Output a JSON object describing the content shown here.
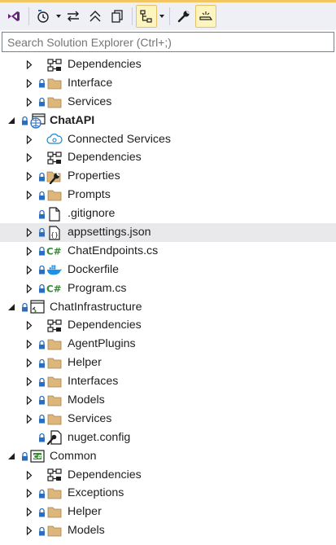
{
  "search": {
    "placeholder": "Search Solution Explorer (Ctrl+;)"
  },
  "toolbar": {
    "buttons": [
      {
        "icon": "vs-solution-icon"
      },
      {
        "icon": "history-icon",
        "dropdown": true
      },
      {
        "icon": "sync-icon"
      },
      {
        "icon": "collapse-all-icon"
      },
      {
        "icon": "copy-icon"
      },
      {
        "icon": "filter-tree-icon",
        "dropdown": true,
        "active": true
      },
      {
        "icon": "wrench-icon"
      },
      {
        "icon": "preview-icon",
        "active": true
      }
    ]
  },
  "tree": [
    {
      "label": "Dependencies",
      "icon": "dependencies-icon",
      "depth": 1,
      "expander": "collapsed",
      "lock": false
    },
    {
      "label": "Interface",
      "icon": "folder-icon",
      "depth": 1,
      "expander": "collapsed",
      "lock": true
    },
    {
      "label": "Services",
      "icon": "folder-icon",
      "depth": 1,
      "expander": "collapsed",
      "lock": true
    },
    {
      "label": "ChatAPI",
      "icon": "web-project-icon",
      "depth": 0,
      "expander": "expanded",
      "lock": true,
      "bold": true
    },
    {
      "label": "Connected Services",
      "icon": "connected-services-icon",
      "depth": 1,
      "expander": "collapsed",
      "lock": false
    },
    {
      "label": "Dependencies",
      "icon": "dependencies-icon",
      "depth": 1,
      "expander": "collapsed",
      "lock": false
    },
    {
      "label": "Properties",
      "icon": "properties-icon",
      "depth": 1,
      "expander": "collapsed",
      "lock": true
    },
    {
      "label": "Prompts",
      "icon": "folder-icon",
      "depth": 1,
      "expander": "collapsed",
      "lock": true
    },
    {
      "label": ".gitignore",
      "icon": "file-icon",
      "depth": 1,
      "expander": "none",
      "lock": true
    },
    {
      "label": "appsettings.json",
      "icon": "json-file-icon",
      "depth": 1,
      "expander": "collapsed",
      "lock": true,
      "selected": true
    },
    {
      "label": "ChatEndpoints.cs",
      "icon": "csharp-file-icon",
      "depth": 1,
      "expander": "collapsed",
      "lock": true
    },
    {
      "label": "Dockerfile",
      "icon": "docker-icon",
      "depth": 1,
      "expander": "collapsed",
      "lock": true
    },
    {
      "label": "Program.cs",
      "icon": "csharp-file-icon",
      "depth": 1,
      "expander": "collapsed",
      "lock": true
    },
    {
      "label": "ChatInfrastructure",
      "icon": "library-project-icon",
      "depth": 0,
      "expander": "expanded",
      "lock": true
    },
    {
      "label": "Dependencies",
      "icon": "dependencies-icon",
      "depth": 1,
      "expander": "collapsed",
      "lock": false
    },
    {
      "label": "AgentPlugins",
      "icon": "folder-icon",
      "depth": 1,
      "expander": "collapsed",
      "lock": true
    },
    {
      "label": "Helper",
      "icon": "folder-icon",
      "depth": 1,
      "expander": "collapsed",
      "lock": true
    },
    {
      "label": "Interfaces",
      "icon": "folder-icon",
      "depth": 1,
      "expander": "collapsed",
      "lock": true
    },
    {
      "label": "Models",
      "icon": "folder-icon",
      "depth": 1,
      "expander": "collapsed",
      "lock": true
    },
    {
      "label": "Services",
      "icon": "folder-icon",
      "depth": 1,
      "expander": "collapsed",
      "lock": true
    },
    {
      "label": "nuget.config",
      "icon": "config-file-icon",
      "depth": 1,
      "expander": "none",
      "lock": true
    },
    {
      "label": "Common",
      "icon": "csharp-project-icon",
      "depth": 0,
      "expander": "expanded",
      "lock": true
    },
    {
      "label": "Dependencies",
      "icon": "dependencies-icon",
      "depth": 1,
      "expander": "collapsed",
      "lock": false
    },
    {
      "label": "Exceptions",
      "icon": "folder-icon",
      "depth": 1,
      "expander": "collapsed",
      "lock": true
    },
    {
      "label": "Helper",
      "icon": "folder-icon",
      "depth": 1,
      "expander": "collapsed",
      "lock": true
    },
    {
      "label": "Models",
      "icon": "folder-icon",
      "depth": 1,
      "expander": "collapsed",
      "lock": true
    }
  ],
  "colors": {
    "folder": "#dcb67a",
    "lock": "#2a6ebd",
    "csharp": "#388a34",
    "docker": "#1d91e6",
    "purple": "#68217a",
    "selected": "#e9e9ec"
  }
}
